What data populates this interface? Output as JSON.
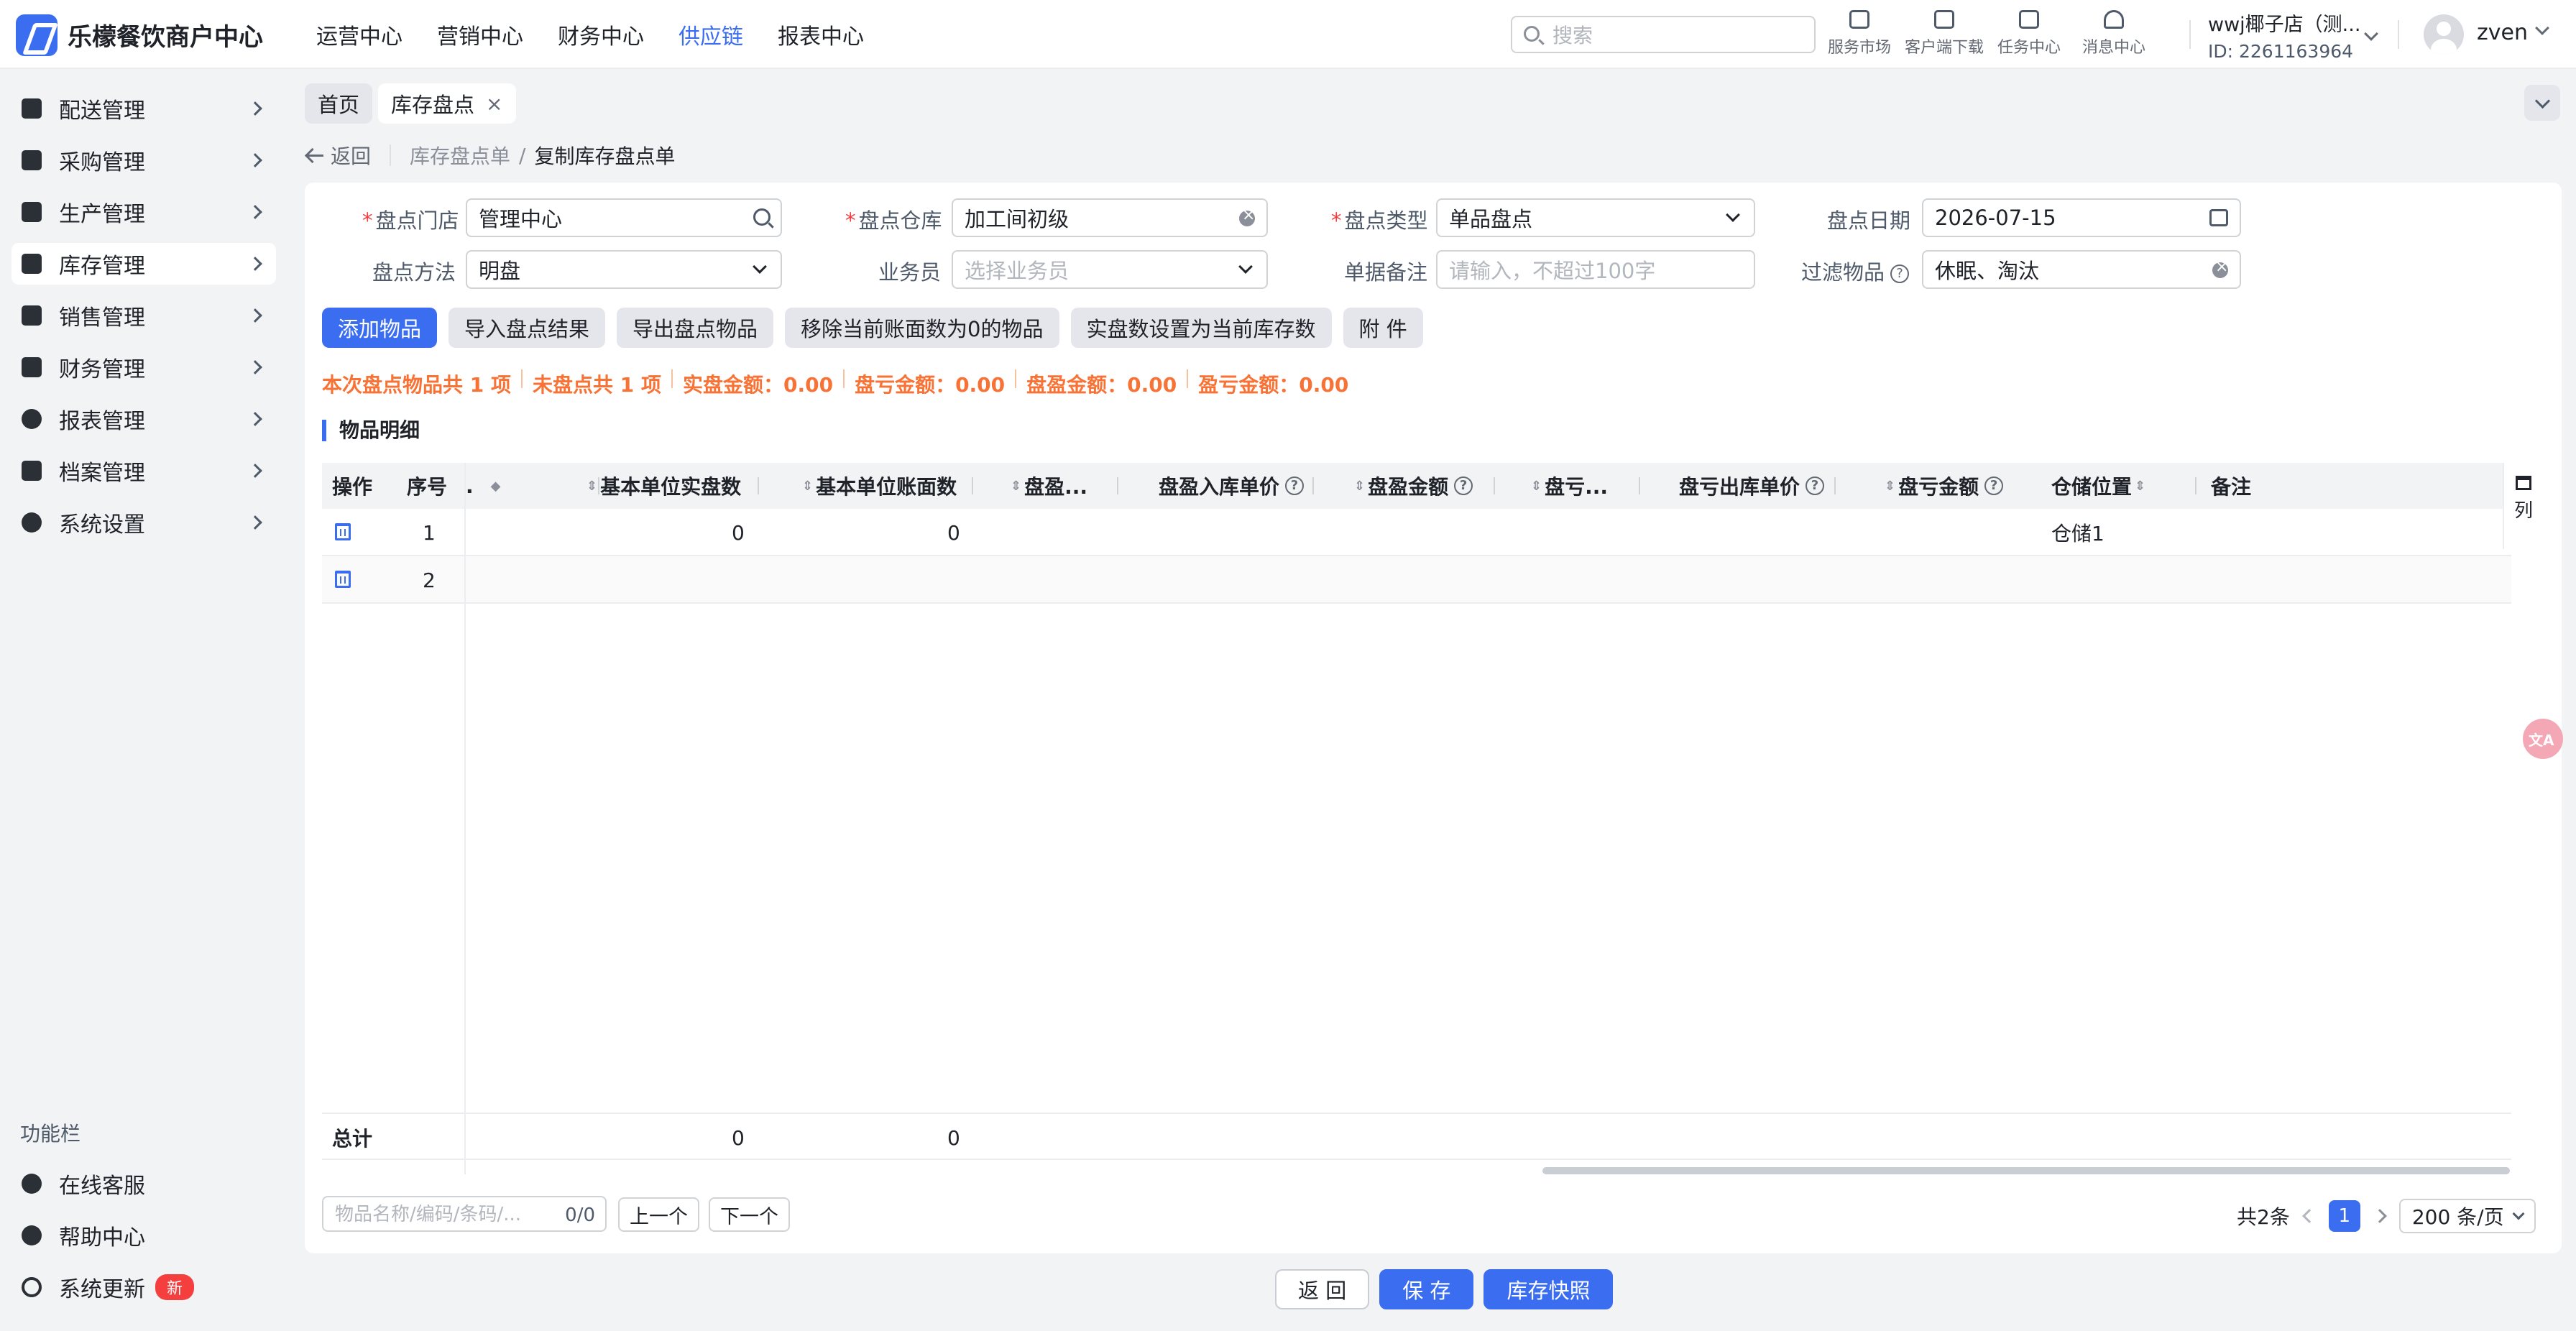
{
  "header": {
    "brand": "乐檬餐饮商户中心",
    "nav": [
      "运营中心",
      "营销中心",
      "财务中心",
      "供应链",
      "报表中心"
    ],
    "active_nav": "供应链",
    "search_placeholder": "搜索",
    "tools": [
      {
        "label": "服务市场",
        "icon": "shop-bag-icon"
      },
      {
        "label": "客户端下载",
        "icon": "download-icon"
      },
      {
        "label": "任务中心",
        "icon": "task-icon"
      },
      {
        "label": "消息中心",
        "icon": "bell-icon"
      }
    ],
    "store_name": "wwj椰子店（测...",
    "store_id": "ID: 2261163964",
    "user_name": "zven"
  },
  "sidebar": {
    "items": [
      {
        "label": "配送管理",
        "icon": "truck-icon"
      },
      {
        "label": "采购管理",
        "icon": "cart-icon"
      },
      {
        "label": "生产管理",
        "icon": "factory-icon"
      },
      {
        "label": "库存管理",
        "icon": "warehouse-icon"
      },
      {
        "label": "销售管理",
        "icon": "sales-icon"
      },
      {
        "label": "财务管理",
        "icon": "finance-icon"
      },
      {
        "label": "报表管理",
        "icon": "report-icon"
      },
      {
        "label": "档案管理",
        "icon": "archive-icon"
      },
      {
        "label": "系统设置",
        "icon": "gear-icon"
      }
    ],
    "active_item": "库存管理",
    "function_title": "功能栏",
    "functions": [
      {
        "label": "在线客服",
        "icon": "service-icon"
      },
      {
        "label": "帮助中心",
        "icon": "help-icon"
      },
      {
        "label": "系统更新",
        "icon": "refresh-icon",
        "badge": "新"
      }
    ]
  },
  "tabs": [
    {
      "label": "首页",
      "active": false
    },
    {
      "label": "库存盘点",
      "active": true,
      "closable": true
    }
  ],
  "breadcrumb": {
    "back": "返回",
    "items": [
      "库存盘点单",
      "复制库存盘点单"
    ]
  },
  "form": {
    "store_label": "盘点门店",
    "store_value": "管理中心",
    "warehouse_label": "盘点仓库",
    "warehouse_value": "加工间初级",
    "type_label": "盘点类型",
    "type_value": "单品盘点",
    "date_label": "盘点日期",
    "date_value": "2026-07-15",
    "method_label": "盘点方法",
    "method_value": "明盘",
    "clerk_label": "业务员",
    "clerk_placeholder": "选择业务员",
    "remark_label": "单据备注",
    "remark_placeholder": "请输入，不超过100字",
    "filter_label": "过滤物品",
    "filter_value": "休眠、淘汰"
  },
  "actions": [
    "添加物品",
    "导入盘点结果",
    "导出盘点物品",
    "移除当前账面数为0的物品",
    "实盘数设置为当前库存数",
    "附 件"
  ],
  "summary": [
    "本次盘点物品共 1 项",
    "未盘点共 1 项",
    "实盘金额：0.00",
    "盘亏金额：0.00",
    "盘盈金额：0.00",
    "盈亏金额：0.00"
  ],
  "section_title": "物品明细",
  "table": {
    "columns": [
      {
        "label": "操作",
        "sort": false
      },
      {
        "label": "序号",
        "sort": false
      },
      {
        "label": ".",
        "sort": true
      },
      {
        "label": "基本单位实盘数",
        "sort": true
      },
      {
        "label": "基本单位账面数",
        "sort": true
      },
      {
        "label": "盘盈...",
        "sort": true
      },
      {
        "label": "盘盈入库单价",
        "sort": false,
        "help": true
      },
      {
        "label": "盘盈金额",
        "sort": true,
        "help": true
      },
      {
        "label": "盘亏...",
        "sort": true
      },
      {
        "label": "盘亏出库单价",
        "sort": false,
        "help": true
      },
      {
        "label": "盘亏金额",
        "sort": true,
        "help": true
      },
      {
        "label": "仓储位置",
        "sort": true
      },
      {
        "label": "备注",
        "sort": false
      }
    ],
    "rows": [
      {
        "seq": "1",
        "actual": "0",
        "book": "0",
        "location": "仓储1"
      },
      {
        "seq": "2",
        "actual": "",
        "book": "",
        "location": ""
      }
    ],
    "total_label": "总计",
    "total_actual": "0",
    "total_book": "0",
    "column_setting": "列"
  },
  "finder": {
    "placeholder": "物品名称/编码/条码/...",
    "count": "0/0",
    "prev": "上一个",
    "next": "下一个"
  },
  "pager": {
    "total": "共2条",
    "current": "1",
    "page_size": "200 条/页"
  },
  "bottom_actions": [
    "返 回",
    "保 存",
    "库存快照"
  ],
  "colors": {
    "primary": "#3a6df0",
    "summary": "#f77234",
    "danger": "#f53f3f"
  }
}
